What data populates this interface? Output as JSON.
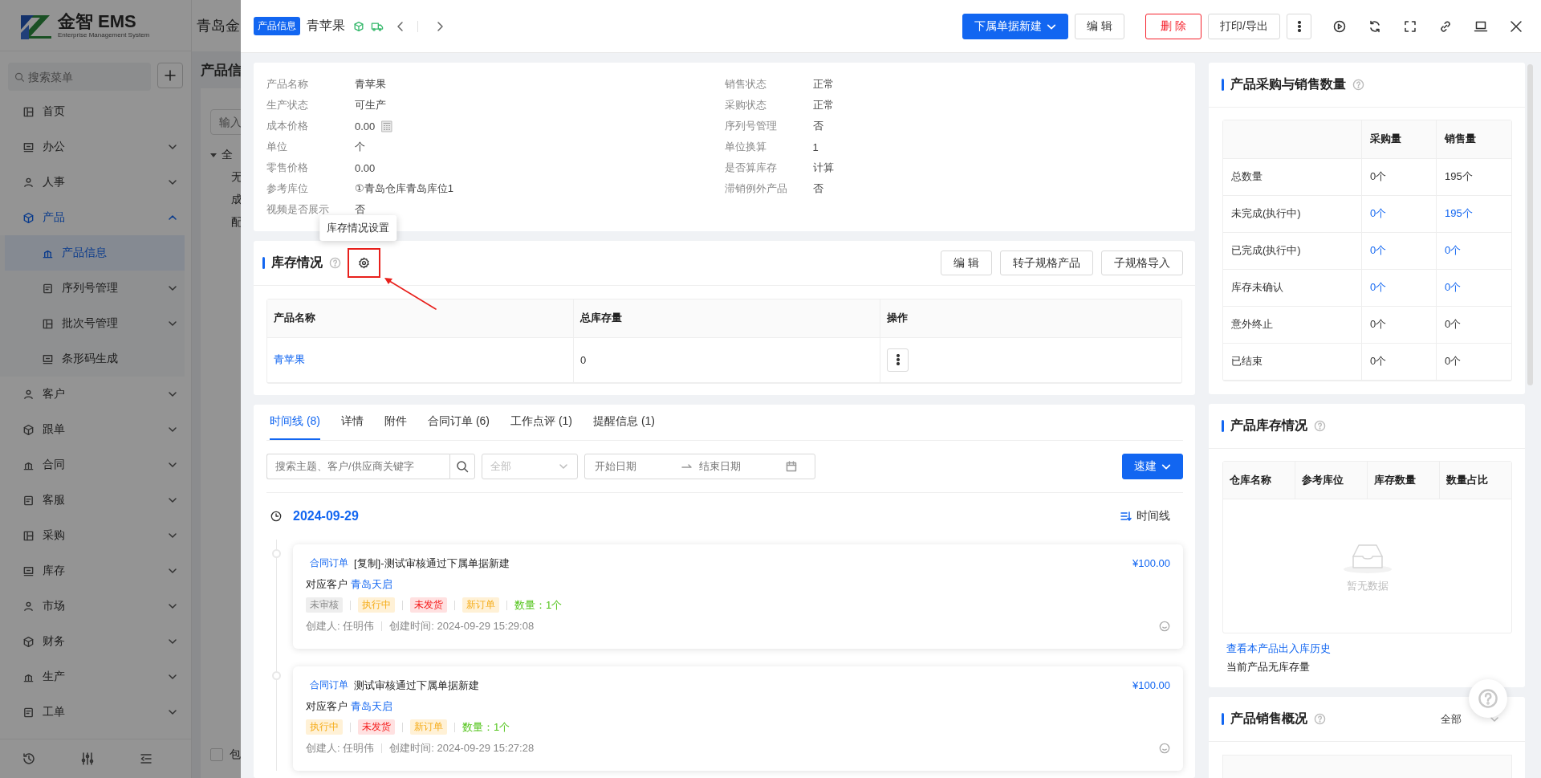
{
  "sidebar": {
    "logo": {
      "brand": "金智 EMS",
      "subtitle": "Enterprise Management System"
    },
    "search_placeholder": "搜索菜单",
    "menu": [
      {
        "label": "首页",
        "kind": "link",
        "selected": false
      },
      {
        "label": "办公",
        "kind": "group",
        "expanded": false,
        "selected": false
      },
      {
        "label": "人事",
        "kind": "group",
        "expanded": false,
        "selected": false
      },
      {
        "label": "产品",
        "kind": "group",
        "expanded": true,
        "selected": false,
        "children": [
          {
            "label": "产品信息",
            "kind": "link",
            "selected": true
          },
          {
            "label": "序列号管理",
            "kind": "group",
            "expanded": false,
            "selected": false
          },
          {
            "label": "批次号管理",
            "kind": "group",
            "expanded": false,
            "selected": false
          },
          {
            "label": "条形码生成",
            "kind": "link",
            "selected": false
          }
        ]
      },
      {
        "label": "客户",
        "kind": "group",
        "expanded": false,
        "selected": false
      },
      {
        "label": "跟单",
        "kind": "group",
        "expanded": false,
        "selected": false
      },
      {
        "label": "合同",
        "kind": "group",
        "expanded": false,
        "selected": false
      },
      {
        "label": "客服",
        "kind": "group",
        "expanded": false,
        "selected": false
      },
      {
        "label": "采购",
        "kind": "group",
        "expanded": false,
        "selected": false
      },
      {
        "label": "库存",
        "kind": "group",
        "expanded": false,
        "selected": false
      },
      {
        "label": "市场",
        "kind": "group",
        "expanded": false,
        "selected": false
      },
      {
        "label": "财务",
        "kind": "group",
        "expanded": false,
        "selected": false
      },
      {
        "label": "生产",
        "kind": "group",
        "expanded": false,
        "selected": false
      },
      {
        "label": "工单",
        "kind": "group",
        "expanded": false,
        "selected": false
      }
    ]
  },
  "background_page": {
    "header_text": "青岛金",
    "title": "产品信",
    "filter_placeholder": "输入",
    "tree": [
      {
        "label": "全",
        "expanded": true,
        "children": [
          {
            "label": "无"
          },
          {
            "label": "成"
          },
          {
            "label": "配"
          }
        ]
      }
    ],
    "footer_checkbox": {
      "label": "包",
      "checked": false
    }
  },
  "drawer": {
    "badge": "产品信息",
    "title": "青苹果",
    "actions": [
      {
        "label": "下属单据新建",
        "kind": "primary"
      },
      {
        "label": "编 辑",
        "kind": "default"
      },
      {
        "label": "删 除",
        "kind": "danger"
      },
      {
        "label": "打印/导出",
        "kind": "default"
      }
    ]
  },
  "product_info": {
    "left": [
      {
        "label": "产品名称",
        "value": "青苹果",
        "kind": "text"
      },
      {
        "label": "生产状态",
        "value": "可生产",
        "kind": "text"
      },
      {
        "label": "成本价格",
        "value": "0.00",
        "kind": "calc"
      },
      {
        "label": "单位",
        "value": "个",
        "kind": "text"
      },
      {
        "label": "零售价格",
        "value": "0.00",
        "kind": "text"
      },
      {
        "label": "参考库位",
        "value": "①青岛仓库青岛库位1",
        "kind": "text"
      },
      {
        "label": "视频是否展示",
        "value": "否",
        "kind": "text"
      }
    ],
    "right": [
      {
        "label": "销售状态",
        "value": "正常",
        "kind": "text"
      },
      {
        "label": "采购状态",
        "value": "正常",
        "kind": "text"
      },
      {
        "label": "序列号管理",
        "value": "否",
        "kind": "text"
      },
      {
        "label": "单位换算",
        "value": "1",
        "kind": "text"
      },
      {
        "label": "是否算库存",
        "value": "计算",
        "kind": "text"
      },
      {
        "label": "滞销例外产品",
        "value": "否",
        "kind": "text"
      }
    ]
  },
  "stock": {
    "title": "库存情况",
    "tooltip": "库存情况设置",
    "actions": [
      "编 辑",
      "转子规格产品",
      "子规格导入"
    ],
    "columns": [
      "产品名称",
      "总库存量",
      "操作"
    ],
    "rows": [
      {
        "name": "青苹果",
        "total": "0"
      }
    ]
  },
  "activity": {
    "tabs": [
      {
        "label": "时间线 (8)",
        "selected": true
      },
      {
        "label": "详情",
        "selected": false
      },
      {
        "label": "附件",
        "selected": false
      },
      {
        "label": "合同订单 (6)",
        "selected": false
      },
      {
        "label": "工作点评 (1)",
        "selected": false
      },
      {
        "label": "提醒信息 (1)",
        "selected": false
      }
    ],
    "search_placeholder": "搜索主题、客户/供应商关键字",
    "type_select": "全部",
    "start_placeholder": "开始日期",
    "end_placeholder": "结束日期",
    "quick_button": "速建",
    "date": "2024-09-29",
    "view_toggle": "时间线",
    "entries": [
      {
        "type": "合同订单",
        "title": "[复制]-测试审核通过下属单据新建",
        "amount": "¥100.00",
        "customer_label": "对应客户",
        "customer": "青岛天启",
        "tags": [
          {
            "text": "未审核",
            "color": "#eeeeee"
          },
          {
            "text": "执行中",
            "color": "#fff1d6"
          },
          {
            "text": "未发货",
            "color": "#ffe1e1"
          },
          {
            "text": "新订单",
            "color": "#fff1d6"
          }
        ],
        "quantity": "数量：1个",
        "creator": "创建人: 任明伟",
        "created": "创建时间: 2024-09-29 15:29:08"
      },
      {
        "type": "合同订单",
        "title": "测试审核通过下属单据新建",
        "amount": "¥100.00",
        "customer_label": "对应客户",
        "customer": "青岛天启",
        "tags": [
          {
            "text": "执行中",
            "color": "#fff1d6"
          },
          {
            "text": "未发货",
            "color": "#ffe1e1"
          },
          {
            "text": "新订单",
            "color": "#fff1d6"
          }
        ],
        "quantity": "数量：1个",
        "creator": "创建人: 任明伟",
        "created": "创建时间: 2024-09-29 15:27:28"
      }
    ]
  },
  "purchase_sales": {
    "title": "产品采购与销售数量",
    "columns": [
      "采购量",
      "销售量"
    ],
    "rows": [
      {
        "label": "总数量",
        "values": [
          "0个",
          "195个"
        ],
        "link": false
      },
      {
        "label": "未完成(执行中)",
        "values": [
          "0个",
          "195个"
        ],
        "link": true
      },
      {
        "label": "已完成(执行中)",
        "values": [
          "0个",
          "0个"
        ],
        "link": true
      },
      {
        "label": "库存未确认",
        "values": [
          "0个",
          "0个"
        ],
        "link": true
      },
      {
        "label": "意外终止",
        "values": [
          "0个",
          "0个"
        ],
        "link": false
      },
      {
        "label": "已结束",
        "values": [
          "0个",
          "0个"
        ],
        "link": false
      }
    ]
  },
  "stock_overview": {
    "title": "产品库存情况",
    "columns": [
      "仓库名称",
      "参考库位",
      "库存数量",
      "数量占比"
    ],
    "empty_text": "暂无数据",
    "history_link": "查看本产品出入库历史",
    "note": "当前产品无库存量"
  },
  "sales_overview": {
    "title": "产品销售概况",
    "period": "全部"
  }
}
